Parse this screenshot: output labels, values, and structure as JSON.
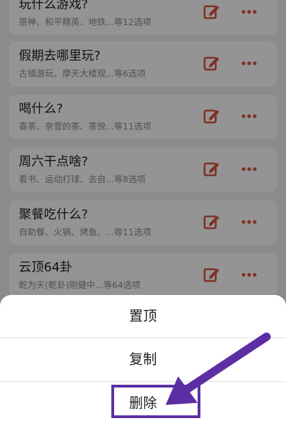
{
  "list": {
    "items": [
      {
        "title": "玩什么游戏?",
        "subtitle": "原神、和平精英、地铁...等12选项"
      },
      {
        "title": "假期去哪里玩?",
        "subtitle": "古镇游玩、摩天大楼观...等6选项"
      },
      {
        "title": "喝什么?",
        "subtitle": "喜茶、奈雪的茶、茶悦...等11选项"
      },
      {
        "title": "周六干点啥?",
        "subtitle": "看书、运动打球、去自...等8选项"
      },
      {
        "title": "聚餐吃什么?",
        "subtitle": "自助餐、火锅、烤鱼、...等11选项"
      },
      {
        "title": "云顶64卦",
        "subtitle": "乾为天(乾卦)刚健中...等64选项"
      }
    ]
  },
  "sheet": {
    "pin_label": "置顶",
    "copy_label": "复制",
    "delete_label": "删除"
  },
  "icons": {
    "edit": "edit-icon",
    "more": "more-icon"
  },
  "colors": {
    "accent": "#d9533f",
    "annotation": "#5b2fa3"
  }
}
